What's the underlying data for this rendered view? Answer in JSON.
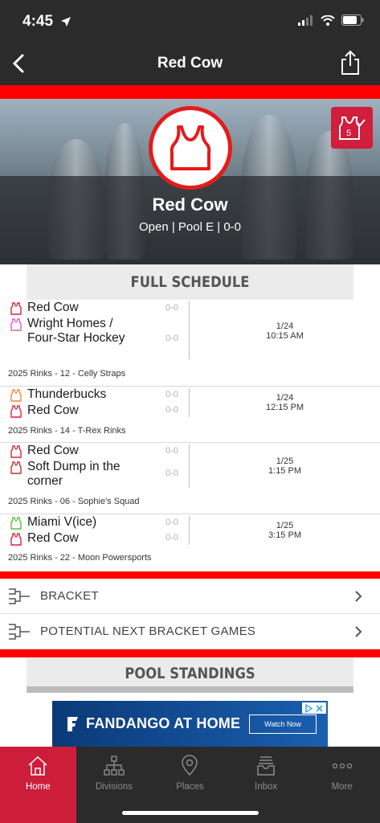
{
  "status_bar": {
    "time": "4:45"
  },
  "nav": {
    "title": "Red Cow"
  },
  "hero": {
    "team_name": "Red Cow",
    "subtitle": "Open | Pool E | 0-0"
  },
  "sections": {
    "schedule_title": "FULL SCHEDULE",
    "standings_title": "POOL STANDINGS"
  },
  "colors": {
    "accent": "#ff0000",
    "tab_active": "#cc1e3b",
    "dark": "#2b2b2b"
  },
  "games": [
    {
      "home": {
        "name": "Red Cow",
        "score": "0-0",
        "color": "#e0213a"
      },
      "away": {
        "name": "Wright Homes / Four-Star Hockey",
        "score": "0-0",
        "color": "#e058d8"
      },
      "date": "1/24",
      "time": "10:15 AM",
      "venue": "2025 Rinks - 12 - Celly Straps"
    },
    {
      "home": {
        "name": "Thunderbucks",
        "score": "0-0",
        "color": "#f08a3c"
      },
      "away": {
        "name": "Red Cow",
        "score": "0-0",
        "color": "#e0213a"
      },
      "date": "1/24",
      "time": "12:15 PM",
      "venue": "2025 Rinks - 14 - T-Rex Rinks"
    },
    {
      "home": {
        "name": "Red Cow",
        "score": "0-0",
        "color": "#e0213a"
      },
      "away": {
        "name": "Soft Dump in the corner",
        "score": "0-0",
        "color": "#c03030"
      },
      "date": "1/25",
      "time": "1:15 PM",
      "venue": "2025 Rinks - 06 - Sophie's Squad"
    },
    {
      "home": {
        "name": "Miami V(ice)",
        "score": "0-0",
        "color": "#58c040"
      },
      "away": {
        "name": "Red Cow",
        "score": "0-0",
        "color": "#e0213a"
      },
      "date": "1/25",
      "time": "3:15 PM",
      "venue": "2025 Rinks - 22 - Moon Powersports"
    }
  ],
  "links": {
    "bracket": "BRACKET",
    "potential": "POTENTIAL NEXT BRACKET GAMES"
  },
  "ad": {
    "brand": "FANDANGO AT HOME",
    "button": "Watch Now"
  },
  "tabs": [
    {
      "label": "Home",
      "icon": "home-icon"
    },
    {
      "label": "Divisions",
      "icon": "divisions-icon"
    },
    {
      "label": "Places",
      "icon": "location-pin-icon"
    },
    {
      "label": "Inbox",
      "icon": "inbox-icon"
    },
    {
      "label": "More",
      "icon": "more-icon"
    }
  ]
}
